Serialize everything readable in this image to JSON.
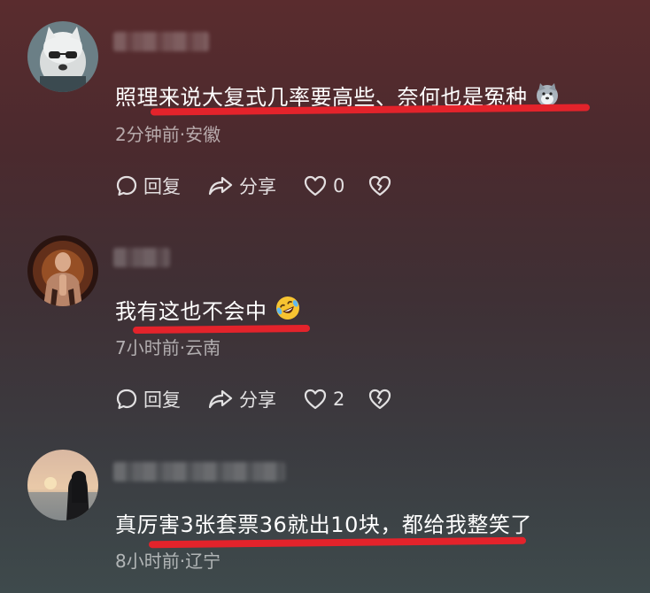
{
  "comments": [
    {
      "text": "照理来说大复式几率要高些、奈何也是冤种",
      "meta": "2分钟前·安徽",
      "reply_label": "回复",
      "share_label": "分享",
      "like_count": "0",
      "emoji": "wolf-emoji"
    },
    {
      "text": "我有这也不会中",
      "meta": "7小时前·云南",
      "reply_label": "回复",
      "share_label": "分享",
      "like_count": "2",
      "emoji": "rofl-emoji"
    },
    {
      "text": "真厉害3张套票36就出10块，都给我整笑了",
      "meta": "8小时前·辽宁"
    }
  ],
  "colors": {
    "underline": "#e3232b",
    "meta_text": "rgba(255,255,255,0.6)"
  },
  "icons": [
    "reply-icon",
    "share-icon",
    "heart-icon",
    "broken-heart-icon"
  ]
}
